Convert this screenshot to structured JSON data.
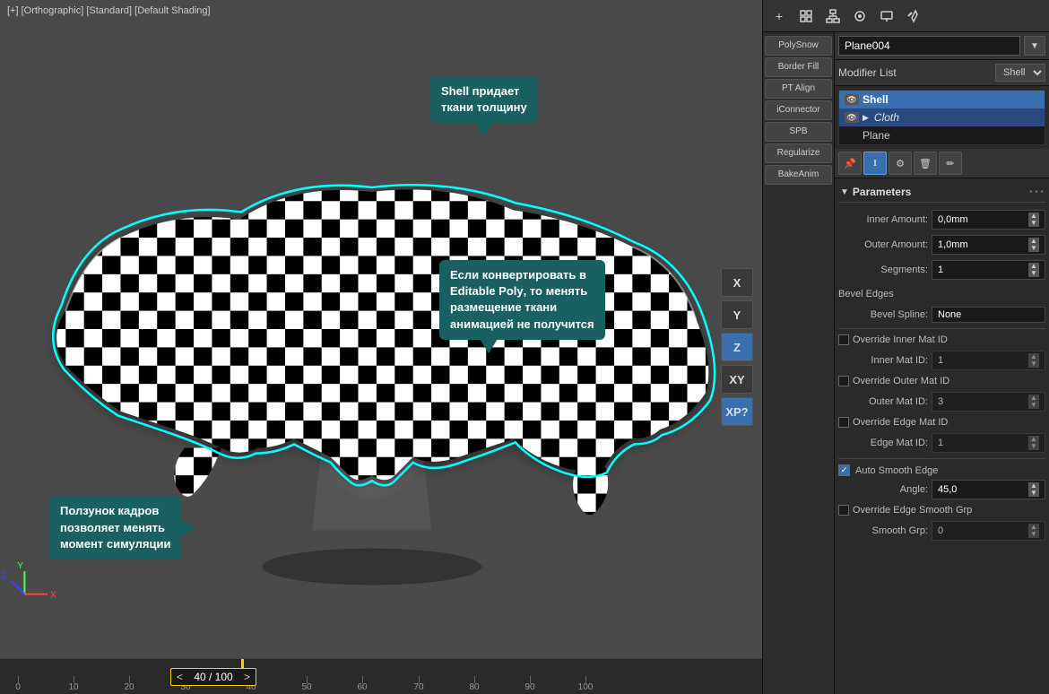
{
  "viewport": {
    "header": "[+] [Orthographic] [Standard] [Default Shading]",
    "frame_current": "40",
    "frame_total": "100",
    "frame_display": "40 / 100"
  },
  "timeline": {
    "ticks": [
      0,
      10,
      20,
      30,
      40,
      50,
      60,
      70,
      80,
      90,
      100
    ],
    "prev_arrow": "<",
    "next_arrow": ">"
  },
  "sidebar": {
    "buttons": [
      "PolySnow",
      "Border Fill",
      "PT Align",
      "iConnector",
      "SPB",
      "Regularize",
      "BakeAnim"
    ]
  },
  "nav_buttons": {
    "x_label": "X",
    "y_label": "Y",
    "z_label": "Z",
    "xy_label": "XY",
    "xp_label": "XP?"
  },
  "toolbar": {
    "icons": [
      "+",
      "⚙",
      "📋",
      "🔧",
      "📐",
      "🗑",
      "✏"
    ]
  },
  "modifier_panel": {
    "object_name": "Plane004",
    "modifier_list_label": "Modifier List",
    "stack": [
      {
        "name": "Shell",
        "active": true,
        "eye": true
      },
      {
        "name": "Cloth",
        "active": false,
        "sub": true,
        "eye": true,
        "has_arrow": true
      },
      {
        "name": "Plane",
        "active": false,
        "base": true
      }
    ],
    "mod_tools": [
      "🔧",
      "I",
      "⚙",
      "🗑",
      "✏"
    ],
    "parameters": {
      "title": "Parameters",
      "inner_amount_label": "Inner Amount:",
      "inner_amount_value": "0,0mm",
      "outer_amount_label": "Outer Amount:",
      "outer_amount_value": "1,0mm",
      "segments_label": "Segments:",
      "segments_value": "1",
      "bevel_edges_label": "Bevel Edges",
      "bevel_spline_label": "Bevel Spline:",
      "bevel_spline_value": "None",
      "override_inner_mat_label": "Override Inner Mat ID",
      "inner_mat_id_label": "Inner Mat ID:",
      "inner_mat_id_value": "1",
      "override_outer_mat_label": "Override Outer Mat ID",
      "outer_mat_id_label": "Outer Mat ID:",
      "outer_mat_id_value": "3",
      "override_edge_mat_label": "Override Edge Mat ID",
      "edge_mat_id_label": "Edge Mat ID:",
      "edge_mat_id_value": "1",
      "auto_smooth_label": "Auto Smooth Edge",
      "angle_label": "Angle:",
      "angle_value": "45,0",
      "override_edge_smooth_label": "Override Edge Smooth Grp",
      "smooth_grp_label": "Smooth Grp:",
      "smooth_grp_value": "0"
    }
  },
  "tooltips": {
    "shell": "Shell придает\nткани толщину",
    "editable": "Если конвертировать в\nEditable Poly, то менять\nразмещение ткани\nанимацией не получится",
    "slider": "Ползунок кадров\nпозволяет менять\nмомент симуляции"
  },
  "colors": {
    "accent_blue": "#3a6faf",
    "accent_cyan": "#00ffff",
    "tooltip_bg": "#1a6060",
    "active_modifier": "#3a6faf",
    "sub_modifier": "#2a4a7f"
  }
}
